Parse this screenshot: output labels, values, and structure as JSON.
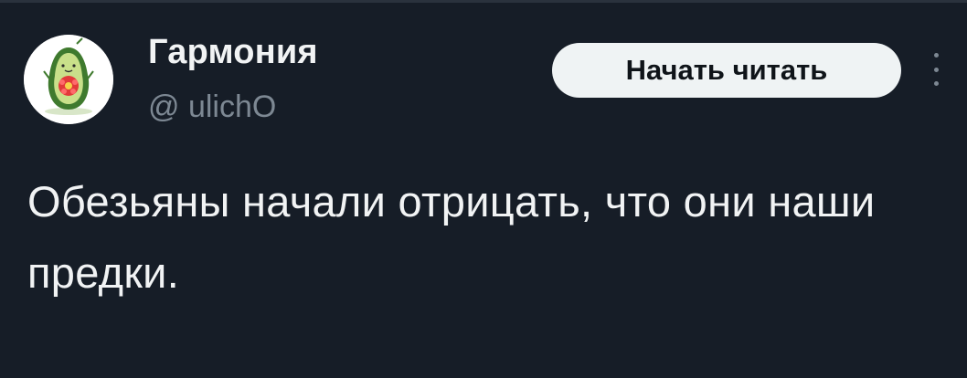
{
  "author": {
    "display_name": "Гармония",
    "handle": "@ ulichO",
    "avatar_icon": "avocado-flower-avatar"
  },
  "actions": {
    "follow_label": "Начать читать",
    "more_icon": "more-vertical-icon"
  },
  "tweet": {
    "text": "Обезьяны начали отрицать, что они наши предки."
  },
  "colors": {
    "background": "#161d27",
    "text_primary": "#f1f3f4",
    "text_secondary": "#7d8893",
    "button_bg": "#eff3f4",
    "button_text": "#0f1419"
  }
}
